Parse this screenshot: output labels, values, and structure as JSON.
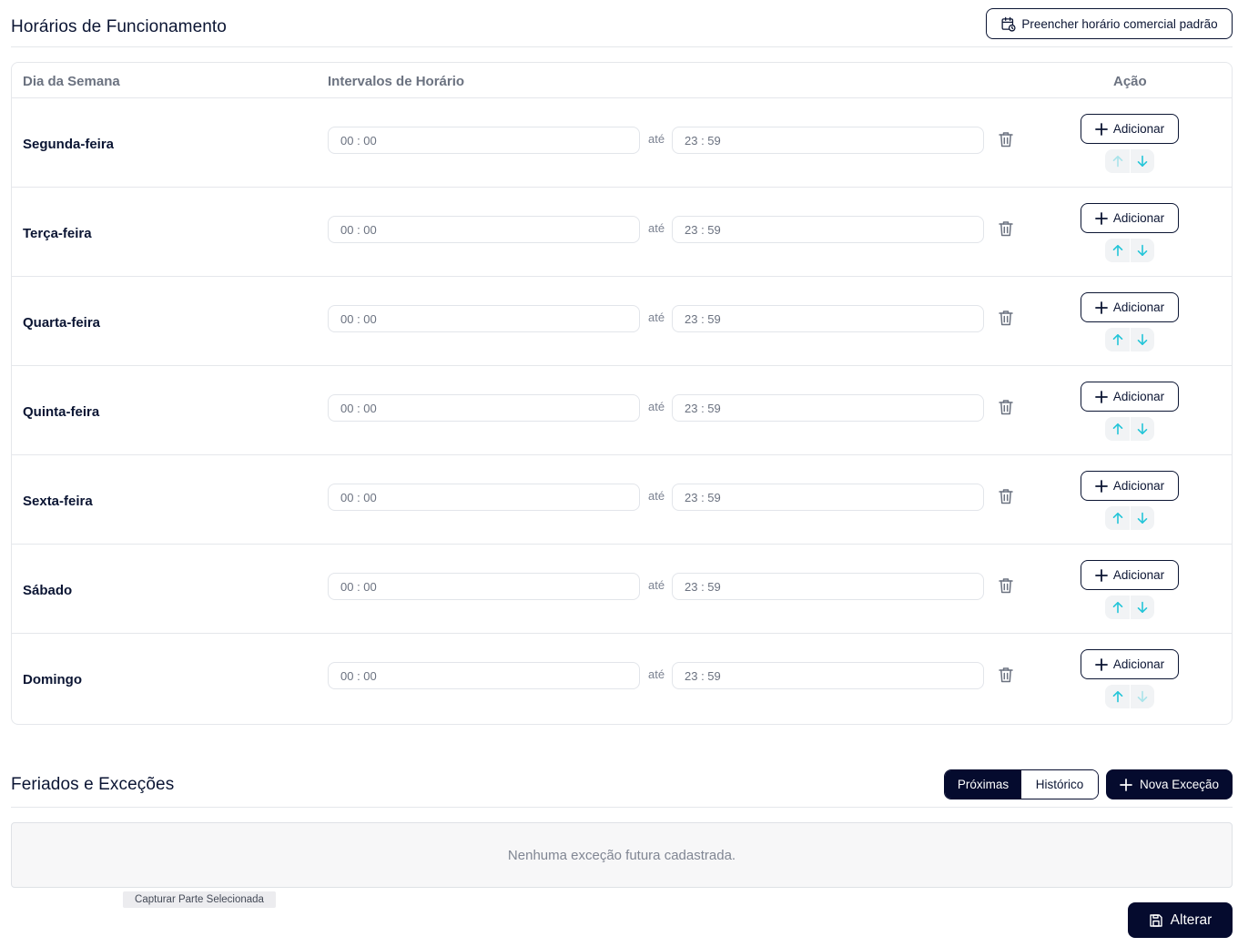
{
  "hours_section": {
    "title": "Horários de Funcionamento",
    "fill_default_label": "Preencher horário comercial padrão",
    "fill_default_icon": "calendar-clock-icon"
  },
  "table": {
    "headers": {
      "day": "Dia da Semana",
      "intervals": "Intervalos de Horário",
      "action": "Ação"
    },
    "separator": "até",
    "add_label": "Adicionar",
    "rows": [
      {
        "day": "Segunda-feira",
        "start": "00 : 00",
        "end": "23 : 59",
        "up_enabled": false,
        "down_enabled": true
      },
      {
        "day": "Terça-feira",
        "start": "00 : 00",
        "end": "23 : 59",
        "up_enabled": true,
        "down_enabled": true
      },
      {
        "day": "Quarta-feira",
        "start": "00 : 00",
        "end": "23 : 59",
        "up_enabled": true,
        "down_enabled": true
      },
      {
        "day": "Quinta-feira",
        "start": "00 : 00",
        "end": "23 : 59",
        "up_enabled": true,
        "down_enabled": true
      },
      {
        "day": "Sexta-feira",
        "start": "00 : 00",
        "end": "23 : 59",
        "up_enabled": true,
        "down_enabled": true
      },
      {
        "day": "Sábado",
        "start": "00 : 00",
        "end": "23 : 59",
        "up_enabled": true,
        "down_enabled": true
      },
      {
        "day": "Domingo",
        "start": "00 : 00",
        "end": "23 : 59",
        "up_enabled": true,
        "down_enabled": false
      }
    ]
  },
  "exceptions_section": {
    "title": "Feriados e Exceções",
    "tab_upcoming": "Próximas",
    "tab_history": "Histórico",
    "active_tab": "Próximas",
    "new_exception_label": "Nova Exceção",
    "empty_message": "Nenhuma exceção futura cadastrada."
  },
  "capture_tag": "Capturar Parte Selecionada",
  "save_button": {
    "label": "Alterar",
    "icon": "save-icon"
  },
  "colors": {
    "primary_dark": "#050b2e",
    "arrow_cyan": "#22c5d8",
    "border": "#e5e7eb",
    "muted_text": "#6b7280"
  }
}
